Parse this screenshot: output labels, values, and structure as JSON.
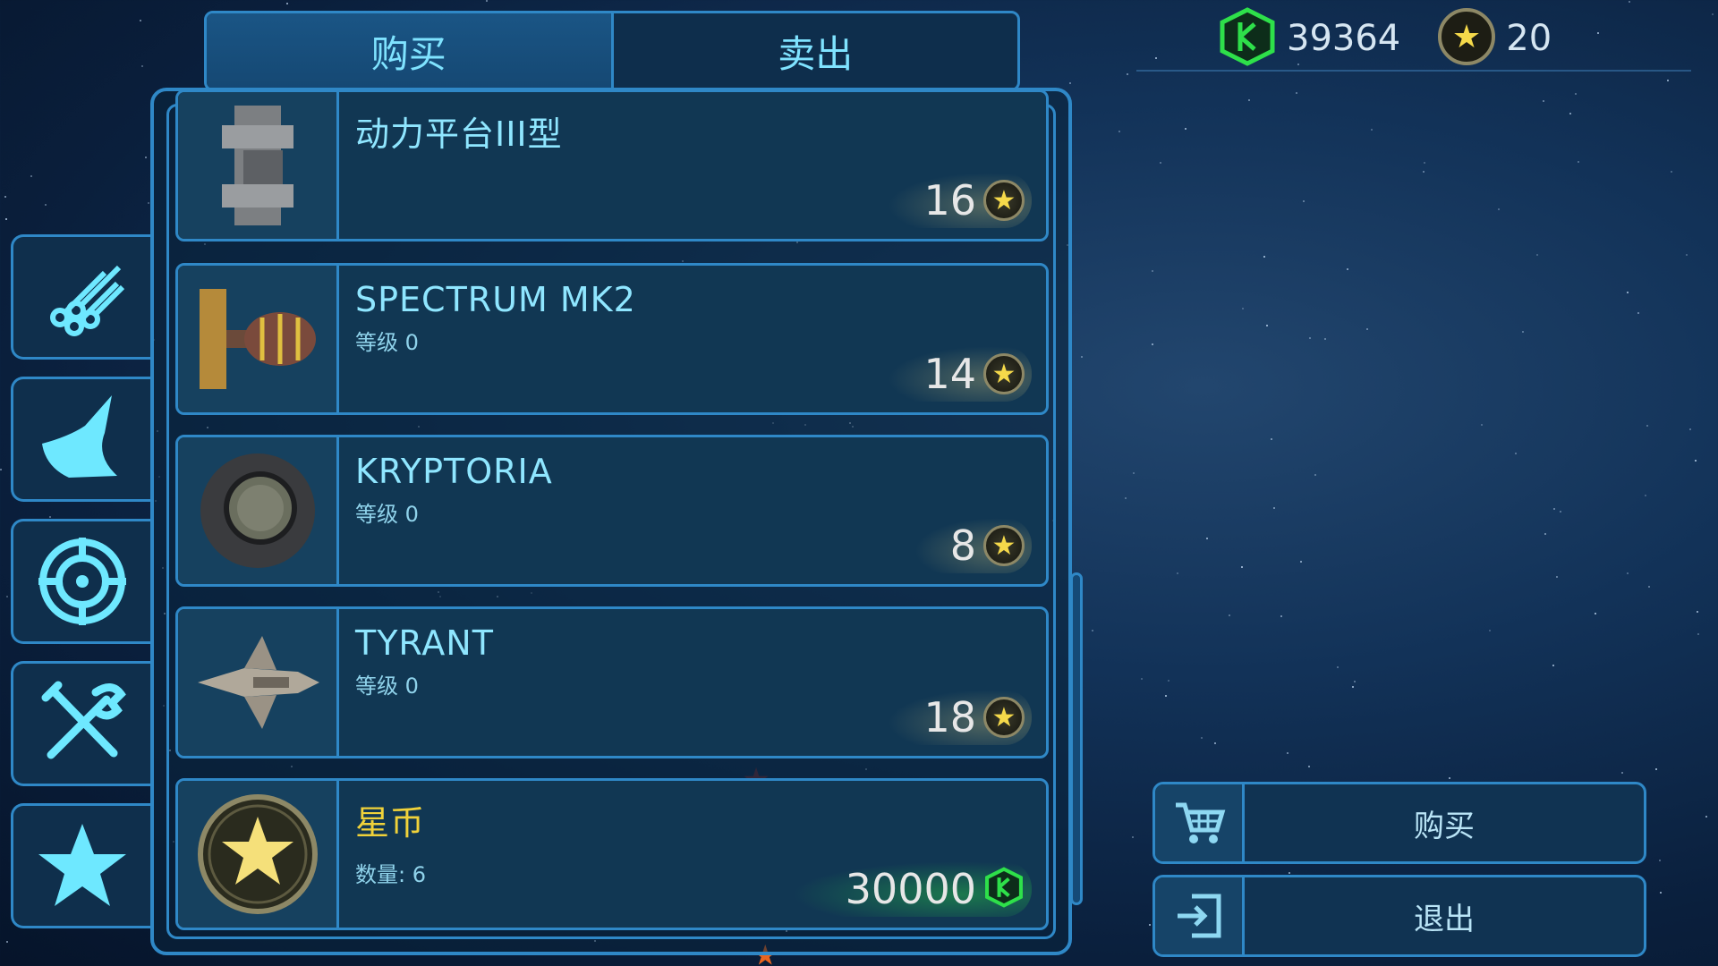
{
  "tabs": [
    {
      "label": "购买",
      "active": true
    },
    {
      "label": "卖出",
      "active": false
    }
  ],
  "currency": {
    "credits": "39364",
    "credits_icon": "green-crystal-icon",
    "stars": "20",
    "stars_icon": "star-coin-icon"
  },
  "categories": [
    {
      "icon": "pipes-icon"
    },
    {
      "icon": "hull-part-icon"
    },
    {
      "icon": "crosshair-icon"
    },
    {
      "icon": "tools-icon"
    },
    {
      "icon": "star-icon"
    }
  ],
  "items": [
    {
      "name": "动力平台III型",
      "sub": "",
      "price": "16",
      "currency": "star",
      "thumb": "power-platform-icon"
    },
    {
      "name": "SPECTRUM MK2",
      "sub": "等级 0",
      "price": "14",
      "currency": "star",
      "thumb": "spectrum-ship-icon"
    },
    {
      "name": "KRYPTORIA",
      "sub": "等级 0",
      "price": "8",
      "currency": "star",
      "thumb": "kryptoria-ship-icon"
    },
    {
      "name": "TYRANT",
      "sub": "等级 0",
      "price": "18",
      "currency": "star",
      "thumb": "tyrant-ship-icon"
    },
    {
      "name": "星币",
      "sub": "数量: 6",
      "price": "30000",
      "currency": "credits",
      "thumb": "star-coin-icon"
    }
  ],
  "actions": {
    "buy_label": "购买",
    "exit_label": "退出"
  },
  "colors": {
    "accent": "#2f88c7",
    "panel": "#113753",
    "text_cyan": "#8fe6ff",
    "gold": "#f0d23a",
    "green": "#2ee04a"
  }
}
